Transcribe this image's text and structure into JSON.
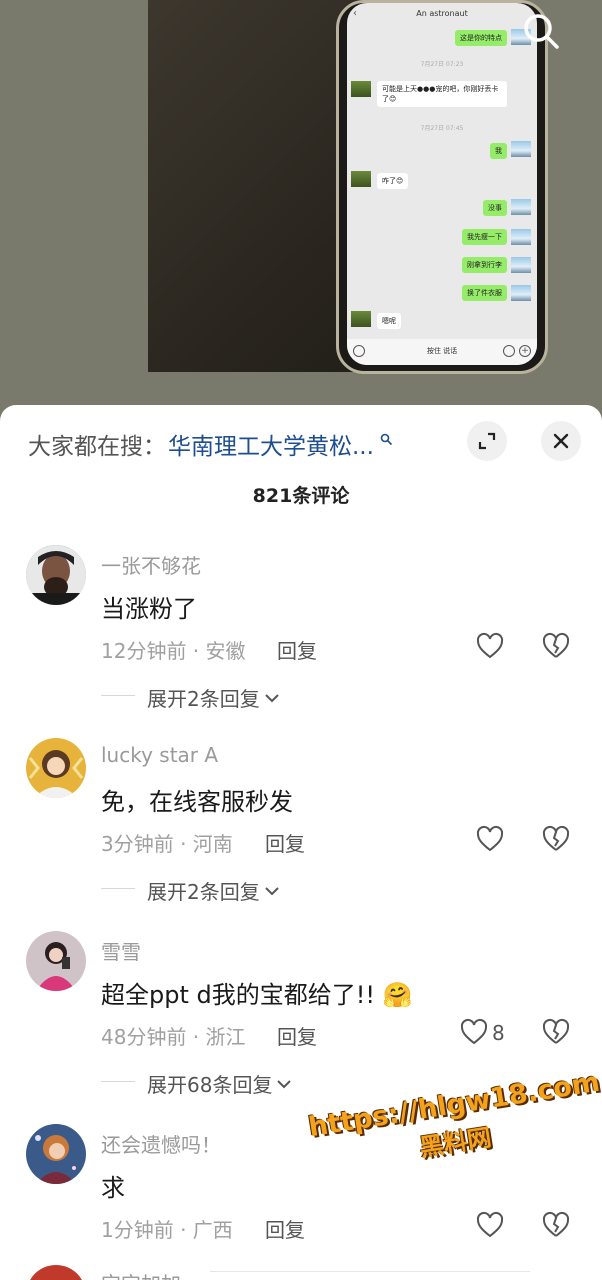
{
  "video": {
    "chat": {
      "title": "An astronaut",
      "back_glyph": "‹",
      "messages": [
        {
          "side": "mine",
          "text": "这是你的特点"
        },
        {
          "side": "time",
          "text": "7月27日 07:23"
        },
        {
          "side": "theirs",
          "text": "可能是上天●●●宠的吧，你刚好丢卡了😊"
        },
        {
          "side": "time",
          "text": "7月27日 07:45"
        },
        {
          "side": "mine",
          "text": "我"
        },
        {
          "side": "theirs",
          "text": "咋了😊"
        },
        {
          "side": "mine",
          "text": "没事"
        },
        {
          "side": "mine",
          "text": "我先瘦一下"
        },
        {
          "side": "mine",
          "text": "刚拿到行李"
        },
        {
          "side": "mine",
          "text": "换了件衣服"
        },
        {
          "side": "theirs",
          "text": "嗯呢"
        }
      ],
      "input_hint": "按住 说话"
    }
  },
  "sheet": {
    "search_label": "大家都在搜：",
    "search_term": "华南理工大学黄松...",
    "count": "821条评论",
    "comments": [
      {
        "username": "一张不够花",
        "text": "当涨粉了",
        "meta": "12分钟前 · 安徽",
        "reply": "回复",
        "likes": "",
        "expand": "展开2条回复"
      },
      {
        "username": "lucky star A",
        "text": "免，在线客服秒发",
        "meta": "3分钟前 · 河南",
        "reply": "回复",
        "likes": "",
        "expand": "展开2条回复"
      },
      {
        "username": "雪雪",
        "text": "超全ppt  d我的宝都给了!! 🤗",
        "meta": "48分钟前 · 浙江",
        "reply": "回复",
        "likes": "8",
        "expand": "展开68条回复"
      },
      {
        "username": "还会遗憾吗！",
        "text": "求",
        "meta": "1分钟前 · 广西",
        "reply": "回复",
        "likes": "",
        "expand": ""
      }
    ],
    "next_username": "宝宝加加"
  },
  "watermark": {
    "url": "https://hlgw18.com",
    "name": "黑料网"
  },
  "colors": {
    "accent_link": "#1d4e8f",
    "chat_green": "#95ec69",
    "watermark": "#f3a21c"
  }
}
